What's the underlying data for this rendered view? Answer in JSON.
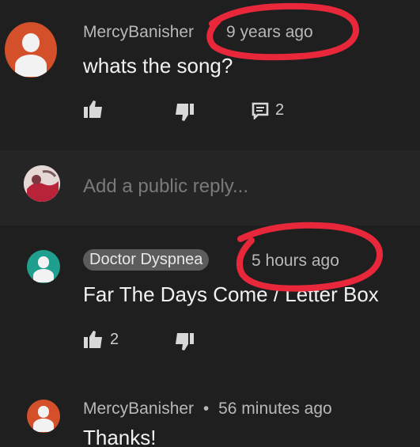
{
  "comments": [
    {
      "author": "MercyBanisher",
      "time": "9 years ago",
      "text": "whats the song?",
      "like_count": "",
      "reply_count": "2"
    },
    {
      "author": "Doctor Dyspnea",
      "time": "5 hours ago",
      "text": "Far The Days Come / Letter Box",
      "like_count": "2"
    },
    {
      "author": "MercyBanisher",
      "separator": "•",
      "time": "56 minutes ago",
      "text": "Thanks!"
    }
  ],
  "reply_box": {
    "placeholder": "Add a public reply..."
  },
  "colors": {
    "background": "#1e1e1e",
    "annotation_red": "#e8283a",
    "avatar_orange": "#d4502a",
    "avatar_teal": "#1f9f8e"
  },
  "icons": [
    "like-icon",
    "dislike-icon",
    "comment-icon",
    "user-avatar-icon"
  ]
}
